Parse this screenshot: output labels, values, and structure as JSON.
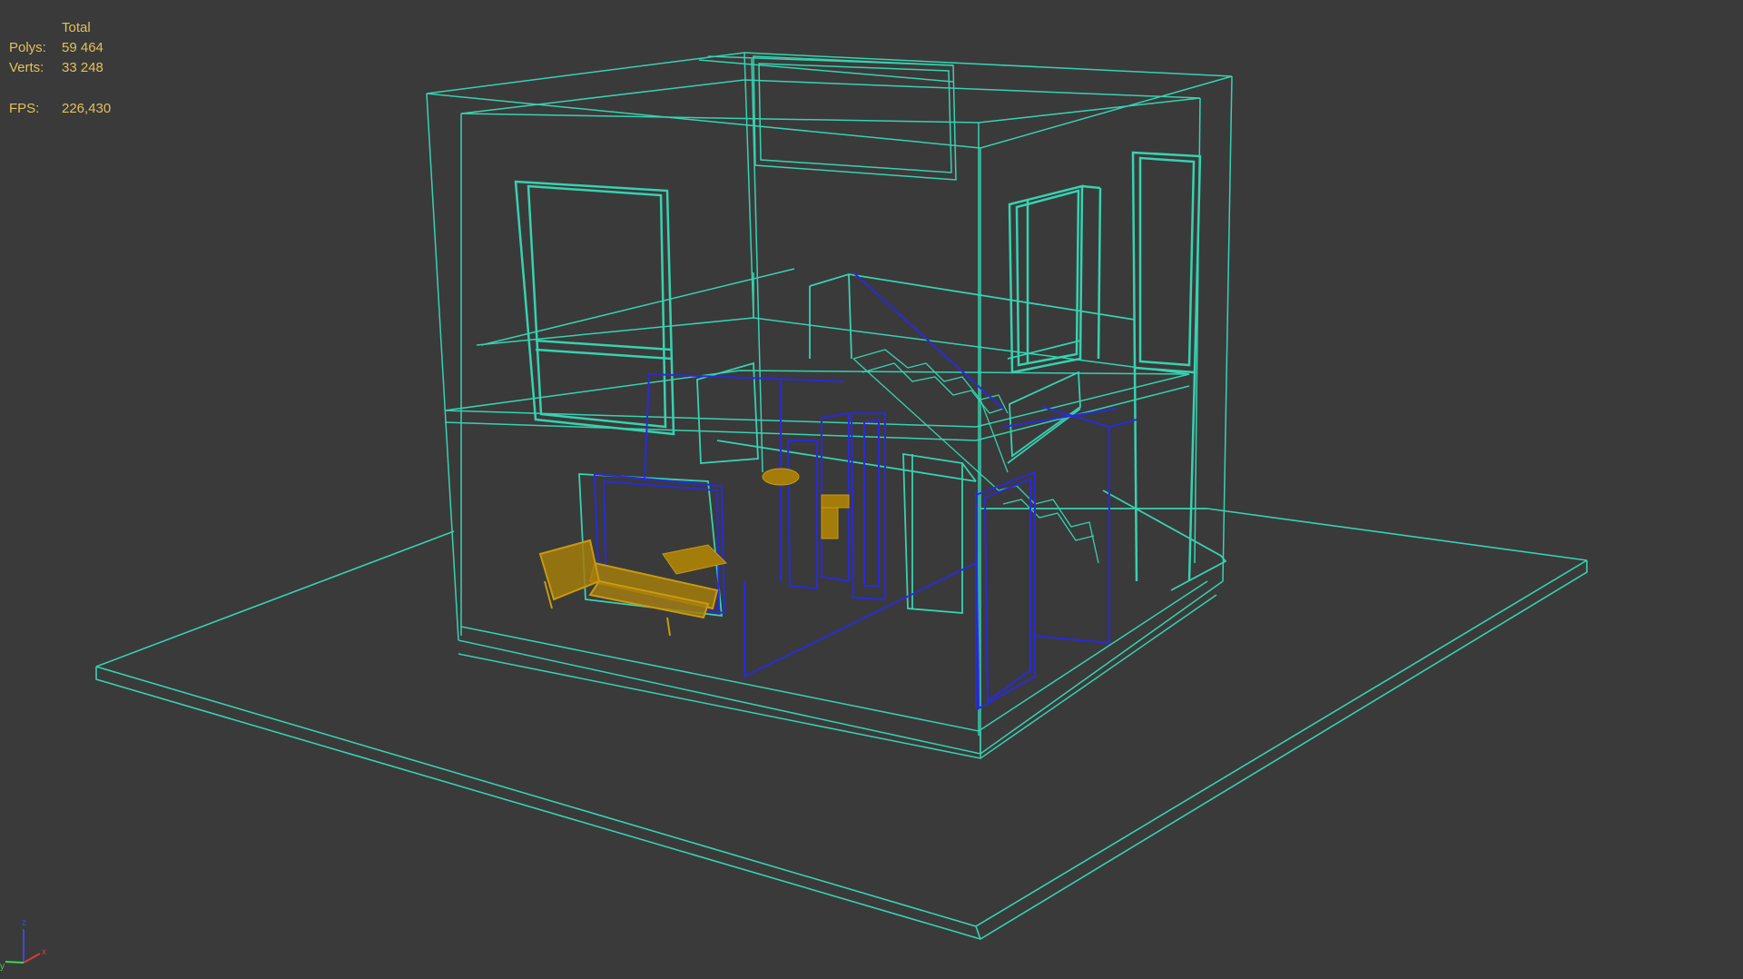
{
  "stats": {
    "header": "Total",
    "polys_label": "Polys:",
    "polys_value": "59 464",
    "verts_label": "Verts:",
    "verts_value": "33 248",
    "fps_label": "FPS:",
    "fps_value": "226,430"
  },
  "axis_gizmo": {
    "z_label": "z",
    "x_label": "x",
    "y_label": "y"
  },
  "colors": {
    "background": "#3a3a3a",
    "wire_teal": "#37d2b0",
    "wire_blue": "#2a2ad8",
    "wire_gold": "#c89a0f",
    "stats_text": "#e3c15a"
  }
}
